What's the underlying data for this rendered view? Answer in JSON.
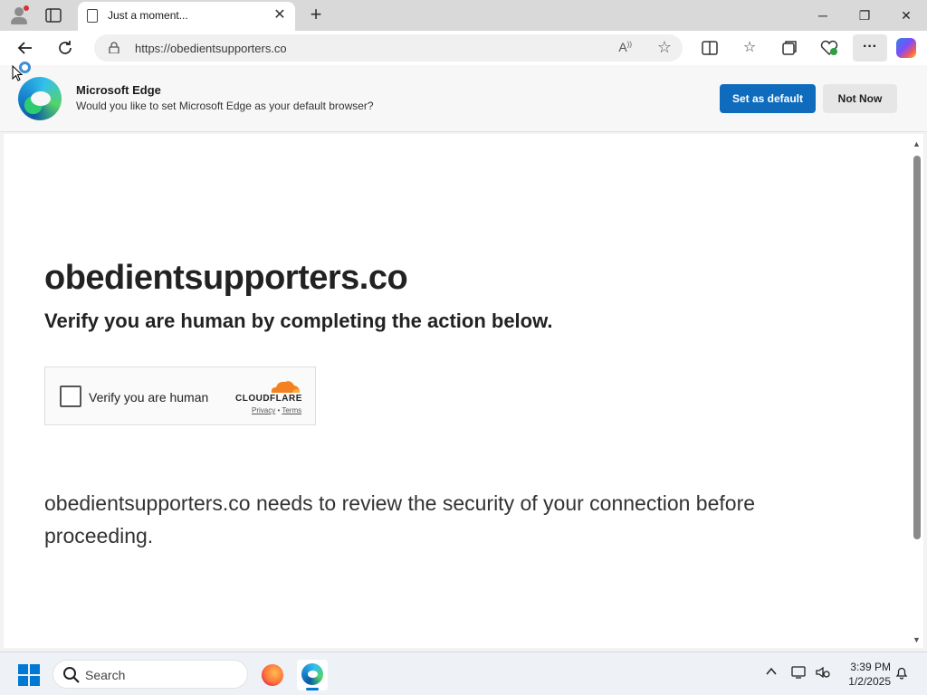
{
  "browser": {
    "tab": {
      "title": "Just a moment..."
    },
    "address_bar": {
      "url": "https://obedientsupporters.co"
    }
  },
  "banner": {
    "title": "Microsoft Edge",
    "message": "Would you like to set Microsoft Edge as your default browser?",
    "primary_button": "Set as default",
    "secondary_button": "Not Now"
  },
  "page": {
    "heading": "obedientsupporters.co",
    "subheading": "Verify you are human by completing the action below.",
    "captcha": {
      "checkbox_label": "Verify you are human",
      "brand": "CLOUDFLARE",
      "privacy_link": "Privacy",
      "separator": "•",
      "terms_link": "Terms"
    },
    "description": "obedientsupporters.co needs to review the security of your connection before proceeding."
  },
  "taskbar": {
    "search_label": "Search",
    "time": "3:39 PM",
    "date": "1/2/2025"
  },
  "colors": {
    "accent": "#0f6cbd",
    "cloudflare_orange": "#f48120"
  }
}
